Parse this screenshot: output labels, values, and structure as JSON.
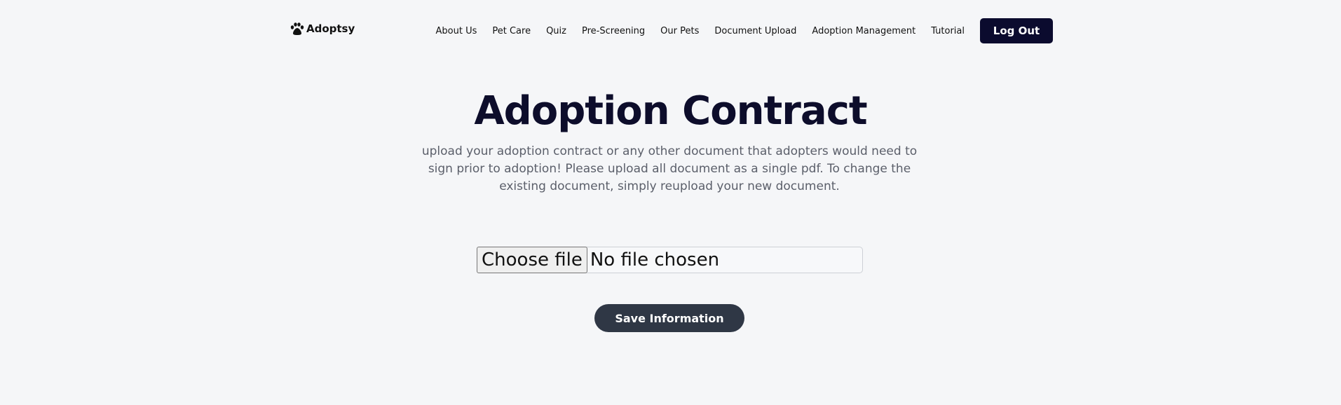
{
  "brand": {
    "name": "Adoptsy",
    "icon": "paw-icon"
  },
  "nav": {
    "items": [
      "About Us",
      "Pet Care",
      "Quiz",
      "Pre-Screening",
      "Our Pets",
      "Document Upload",
      "Adoption Management",
      "Tutorial"
    ],
    "logout": "Log Out"
  },
  "main": {
    "title": "Adoption Contract",
    "description": "upload your adoption contract or any other document that adopters would need to sign prior to adoption! Please upload all document as a single pdf. To change the existing document, simply reupload your new document.",
    "file_button": "Choose file",
    "file_status": "No file chosen",
    "save": "Save Information"
  }
}
